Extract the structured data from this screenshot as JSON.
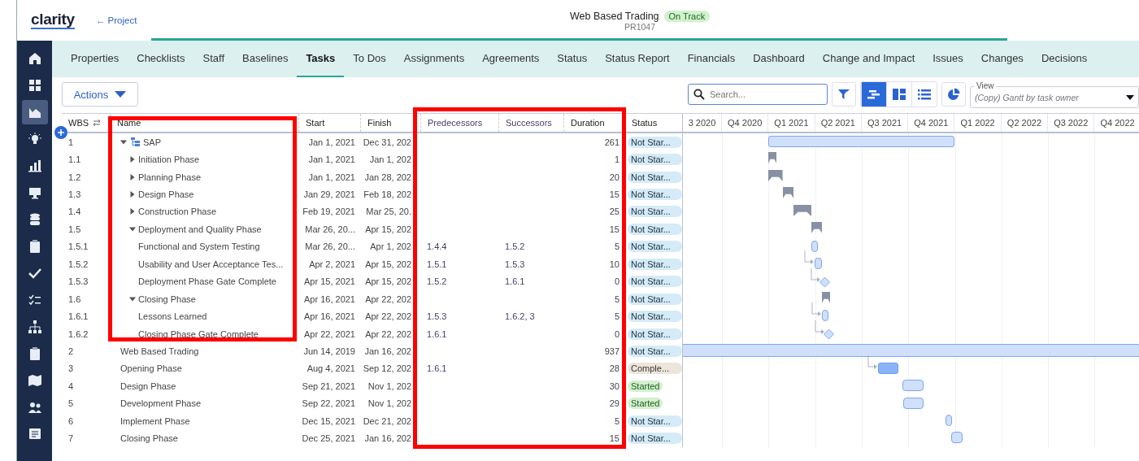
{
  "header": {
    "logo": "clarity",
    "back_link": "← Project",
    "title": "Web Based Trading",
    "health": "On Track",
    "code": "PR1047"
  },
  "sidebar": {
    "items": [
      {
        "selected": false
      },
      {
        "selected": false
      },
      {
        "selected": true
      },
      {
        "selected": false
      },
      {
        "selected": false
      },
      {
        "selected": false
      },
      {
        "selected": false
      },
      {
        "selected": false
      },
      {
        "selected": false
      },
      {
        "selected": false
      },
      {
        "selected": false
      },
      {
        "selected": false
      },
      {
        "selected": false
      },
      {
        "selected": false
      },
      {
        "selected": false
      }
    ]
  },
  "tabs": [
    {
      "label": "Properties",
      "selected": false
    },
    {
      "label": "Checklists",
      "selected": false
    },
    {
      "label": "Staff",
      "selected": false
    },
    {
      "label": "Baselines",
      "selected": false
    },
    {
      "label": "Tasks",
      "selected": true
    },
    {
      "label": "To Dos",
      "selected": false
    },
    {
      "label": "Assignments",
      "selected": false
    },
    {
      "label": "Agreements",
      "selected": false
    },
    {
      "label": "Status",
      "selected": false
    },
    {
      "label": "Status Report",
      "selected": false
    },
    {
      "label": "Financials",
      "selected": false
    },
    {
      "label": "Dashboard",
      "selected": false
    },
    {
      "label": "Change and Impact",
      "selected": false
    },
    {
      "label": "Issues",
      "selected": false
    },
    {
      "label": "Changes",
      "selected": false
    },
    {
      "label": "Decisions",
      "selected": false
    }
  ],
  "toolbar": {
    "actions": "Actions",
    "search": {
      "placeholder": "Search..."
    },
    "views": [
      {
        "kind": "gantt",
        "selected": true
      },
      {
        "kind": "board",
        "selected": false
      },
      {
        "kind": "list",
        "selected": false
      }
    ],
    "view": {
      "label": "View",
      "value": "(Copy) Gantt by task owner"
    }
  },
  "table": {
    "columns": [
      "WBS",
      "Name",
      "Start",
      "Finish",
      "Predecessors",
      "Successors",
      "Duration",
      "Status"
    ],
    "timeline": [
      "3 2020",
      "Q4 2020",
      "Q1 2021",
      "Q2 2021",
      "Q3 2021",
      "Q4 2021",
      "Q1 2022",
      "Q2 2022",
      "Q3 2022",
      "Q4 2022"
    ],
    "rows": [
      {
        "wbs": "1",
        "name": "SAP",
        "start": "Jan 1, 2021",
        "finish": "Dec 31, 202",
        "duration": "261",
        "status": {
          "label": "Not Star...",
          "kind": "not_started"
        },
        "expanded": true,
        "bar": {
          "kind": "summary",
          "linked": false
        },
        "children": [
          {
            "wbs": "1.1",
            "name": "Initiation Phase",
            "start": "Jan 1, 2021",
            "finish": "Jan 1, 202",
            "duration": "1",
            "status": {
              "label": "Not Star...",
              "kind": "not_started"
            },
            "expanded": false,
            "bar": {
              "kind": "phase",
              "linked": false
            }
          },
          {
            "wbs": "1.2",
            "name": "Planning Phase",
            "start": "Jan 1, 2021",
            "finish": "Jan 28, 202",
            "duration": "20",
            "status": {
              "label": "Not Star...",
              "kind": "not_started"
            },
            "expanded": false,
            "bar": {
              "kind": "phase",
              "linked": false
            }
          },
          {
            "wbs": "1.3",
            "name": "Design Phase",
            "start": "Jan 29, 2021",
            "finish": "Feb 18, 202",
            "duration": "15",
            "status": {
              "label": "Not Star...",
              "kind": "not_started"
            },
            "expanded": false,
            "bar": {
              "kind": "phase",
              "linked": false
            }
          },
          {
            "wbs": "1.4",
            "name": "Construction Phase",
            "start": "Feb 19, 2021",
            "finish": "Mar 25, 20.",
            "duration": "25",
            "status": {
              "label": "Not Star...",
              "kind": "not_started"
            },
            "expanded": false,
            "bar": {
              "kind": "phase",
              "linked": false
            }
          },
          {
            "wbs": "1.5",
            "name": "Deployment and Quality Phase",
            "start": "Mar 26, 20...",
            "finish": "Apr 15, 202",
            "duration": "15",
            "status": {
              "label": "Not Star...",
              "kind": "not_started"
            },
            "expanded": true,
            "bar": {
              "kind": "phase",
              "linked": false
            },
            "children": [
              {
                "wbs": "1.5.1",
                "name": "Functional and System Testing",
                "start": "Mar 26, 20...",
                "finish": "Apr 1, 202",
                "predecessors": "1.4.4",
                "successors": "1.5.2",
                "duration": "5",
                "status": {
                  "label": "Not Star...",
                  "kind": "not_started"
                },
                "bar": {
                  "kind": "task",
                  "linked": false
                }
              },
              {
                "wbs": "1.5.2",
                "name": "Usability and User Acceptance Tes...",
                "start": "Apr 2, 2021",
                "finish": "Apr 15, 202",
                "predecessors": "1.5.1",
                "successors": "1.5.3",
                "duration": "10",
                "status": {
                  "label": "Not Star...",
                  "kind": "not_started"
                },
                "bar": {
                  "kind": "task",
                  "linked": true
                }
              },
              {
                "wbs": "1.5.3",
                "name": "Deployment Phase Gate Complete",
                "start": "Apr 15, 2021",
                "finish": "Apr 15, 202",
                "predecessors": "1.5.2",
                "successors": "1.6.1",
                "duration": "0",
                "status": {
                  "label": "Not Star...",
                  "kind": "not_started"
                },
                "bar": {
                  "kind": "milestone",
                  "linked": true
                }
              }
            ]
          },
          {
            "wbs": "1.6",
            "name": "Closing Phase",
            "start": "Apr 16, 2021",
            "finish": "Apr 22, 202",
            "duration": "5",
            "status": {
              "label": "Not Star...",
              "kind": "not_started"
            },
            "expanded": true,
            "bar": {
              "kind": "phase",
              "linked": false
            },
            "children": [
              {
                "wbs": "1.6.1",
                "name": "Lessons Learned",
                "start": "Apr 16, 2021",
                "finish": "Apr 22, 202",
                "predecessors": "1.5.3",
                "successors": "1.6.2, 3",
                "duration": "5",
                "status": {
                  "label": "Not Star...",
                  "kind": "not_started"
                },
                "bar": {
                  "kind": "task",
                  "linked": true
                }
              },
              {
                "wbs": "1.6.2",
                "name": "Closing Phase Gate Complete",
                "start": "Apr 22, 2021",
                "finish": "Apr 22, 202",
                "predecessors": "1.6.1",
                "duration": "0",
                "status": {
                  "label": "Not Star...",
                  "kind": "not_started"
                },
                "bar": {
                  "kind": "milestone",
                  "linked": true
                }
              }
            ]
          }
        ]
      },
      {
        "wbs": "2",
        "name": "Web Based Trading",
        "start": "Jun 14, 2019",
        "finish": "Jan 16, 202",
        "duration": "937",
        "status": {
          "label": "Not Star...",
          "kind": "not_started"
        },
        "bar": {
          "kind": "project",
          "linked": false
        }
      },
      {
        "wbs": "3",
        "name": "Opening Phase",
        "start": "Aug 4, 2021",
        "finish": "Sep 12, 202",
        "predecessors": "1.6.1",
        "duration": "28",
        "status": {
          "label": "Comple...",
          "kind": "completed"
        },
        "bar": {
          "kind": "done",
          "linked": true
        }
      },
      {
        "wbs": "4",
        "name": "Design Phase",
        "start": "Sep 21, 2021",
        "finish": "Nov 1, 202",
        "duration": "30",
        "status": {
          "label": "Started",
          "kind": "started"
        },
        "bar": {
          "kind": "task",
          "linked": false
        }
      },
      {
        "wbs": "5",
        "name": "Development Phase",
        "start": "Sep 22, 2021",
        "finish": "Nov 1, 202",
        "duration": "29",
        "status": {
          "label": "Started",
          "kind": "started"
        },
        "bar": {
          "kind": "task",
          "linked": false
        }
      },
      {
        "wbs": "6",
        "name": "Implement Phase",
        "start": "Dec 15, 2021",
        "finish": "Dec 21, 202",
        "duration": "5",
        "status": {
          "label": "Not Star...",
          "kind": "not_started"
        },
        "bar": {
          "kind": "task",
          "linked": false
        }
      },
      {
        "wbs": "7",
        "name": "Closing Phase",
        "start": "Dec 25, 2021",
        "finish": "Jan 16, 202",
        "duration": "15",
        "status": {
          "label": "Not Star...",
          "kind": "not_started"
        },
        "bar": {
          "kind": "task",
          "linked": false
        }
      }
    ]
  }
}
